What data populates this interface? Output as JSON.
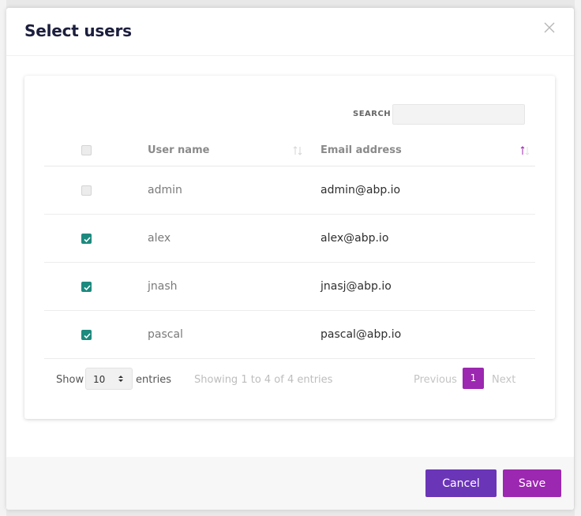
{
  "modal": {
    "title": "Select users",
    "close_icon": "close-icon"
  },
  "search": {
    "label": "SEARCH",
    "value": "",
    "placeholder": ""
  },
  "table": {
    "columns": [
      {
        "label": "User name",
        "sort_state": "unsorted"
      },
      {
        "label": "Email address",
        "sort_state": "ascending"
      }
    ],
    "select_all_checked": false,
    "rows": [
      {
        "username": "admin",
        "email": "admin@abp.io",
        "checked": false
      },
      {
        "username": "alex",
        "email": "alex@abp.io",
        "checked": true
      },
      {
        "username": "jnash",
        "email": "jnasj@abp.io",
        "checked": true
      },
      {
        "username": "pascal",
        "email": "pascal@abp.io",
        "checked": true
      }
    ]
  },
  "footer": {
    "show_label": "Show",
    "page_length": "10",
    "entries_label": "entries",
    "info": "Showing 1 to 4 of 4 entries",
    "previous": "Previous",
    "current_page": "1",
    "next": "Next"
  },
  "actions": {
    "cancel": "Cancel",
    "save": "Save"
  },
  "colors": {
    "accent": "#9c27b0",
    "cancel": "#6b35b8",
    "checkbox_checked": "#1d8a7e",
    "sort_active": "#9c27b0"
  }
}
